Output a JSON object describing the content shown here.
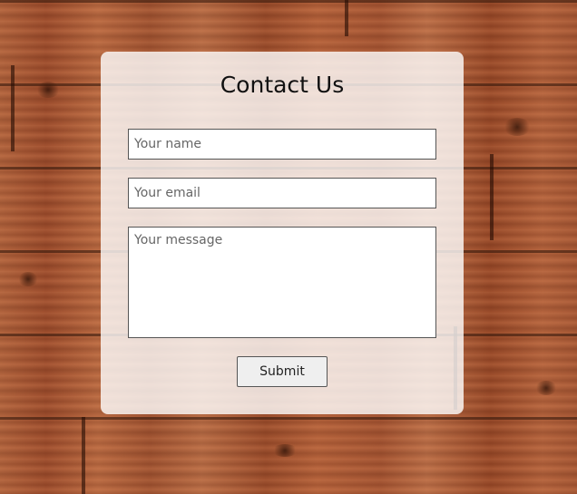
{
  "form": {
    "title": "Contact Us",
    "name_placeholder": "Your name",
    "email_placeholder": "Your email",
    "message_placeholder": "Your message",
    "submit_label": "Submit"
  },
  "colors": {
    "background_wood": "#a9552f",
    "card": "#ffffff",
    "field_border": "#555555"
  }
}
